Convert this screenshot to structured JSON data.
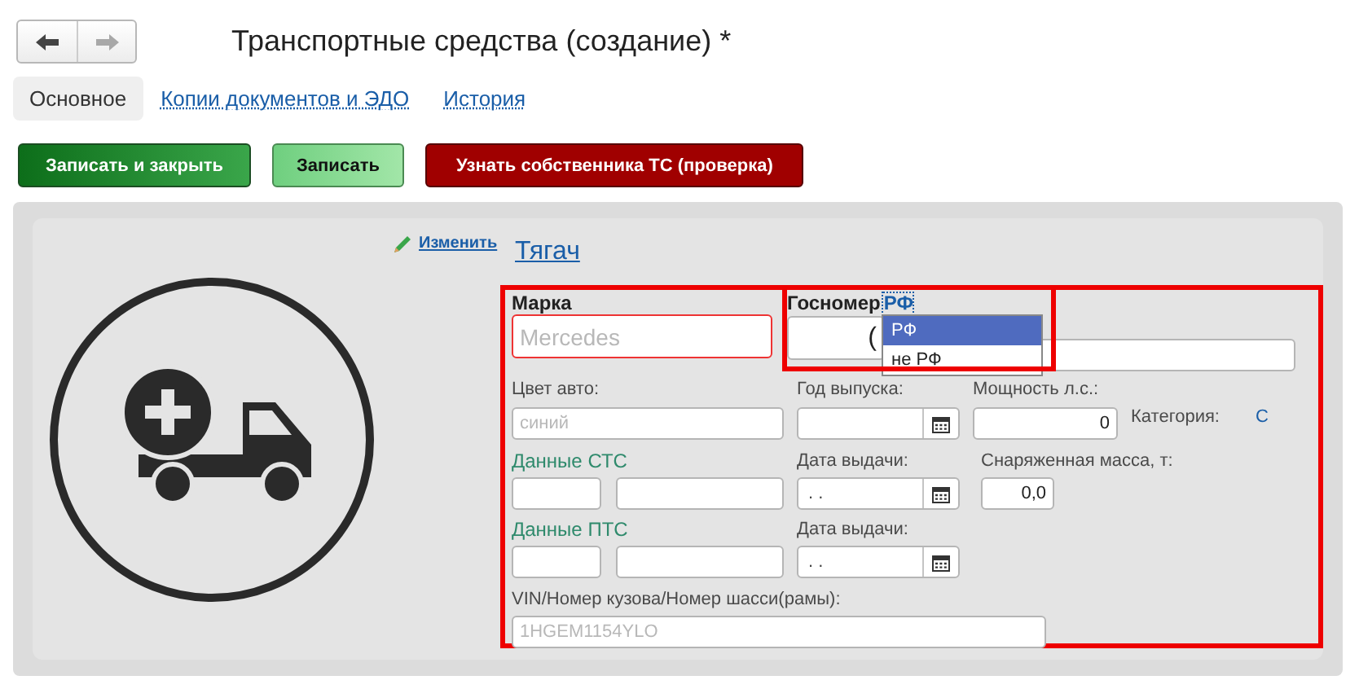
{
  "nav": [
    {
      "kind": "back",
      "disabled": false
    },
    {
      "kind": "forward",
      "disabled": true
    }
  ],
  "window": {
    "title": "Транспортные средства (создание) *"
  },
  "tabs": [
    {
      "label": "Основное",
      "selected": true
    },
    {
      "label": "Копии документов и ЭДО",
      "selected": false
    },
    {
      "label": "История",
      "selected": false
    }
  ],
  "buttons": [
    {
      "label": "Записать и закрыть",
      "kind": "primary"
    },
    {
      "label": "Записать",
      "kind": "secondary"
    },
    {
      "label": "Узнать собственника ТС (проверка)",
      "kind": "danger"
    }
  ],
  "card": {
    "edit_link": "Изменить",
    "type_link": "Тягач",
    "brand": {
      "label": "Марка",
      "placeholder": "Mercedes"
    },
    "plate": {
      "label": "Госномер",
      "country": "РФ",
      "value": "(",
      "dropdown": [
        {
          "label": "РФ",
          "selected": true
        },
        {
          "label": "не РФ",
          "selected": false
        }
      ]
    },
    "color": {
      "label": "Цвет авто:",
      "placeholder": "синий"
    },
    "year": {
      "label": "Год выпуска:"
    },
    "power": {
      "label": "Мощность л.с.:",
      "value": "0"
    },
    "category": {
      "label": "Категория:",
      "value": "С"
    },
    "sts": {
      "label": "Данные СТС",
      "date_label": "Дата выдачи:",
      "date_value": ". ."
    },
    "mass": {
      "label": "Снаряженная масса, т:",
      "value": "0,0"
    },
    "pts": {
      "label": "Данные ПТС",
      "date_label": "Дата выдачи:",
      "date_value": ". ."
    },
    "vin": {
      "label": "VIN/Номер кузова/Номер шасси(рамы):",
      "placeholder": "1HGEM1154YLO"
    }
  }
}
